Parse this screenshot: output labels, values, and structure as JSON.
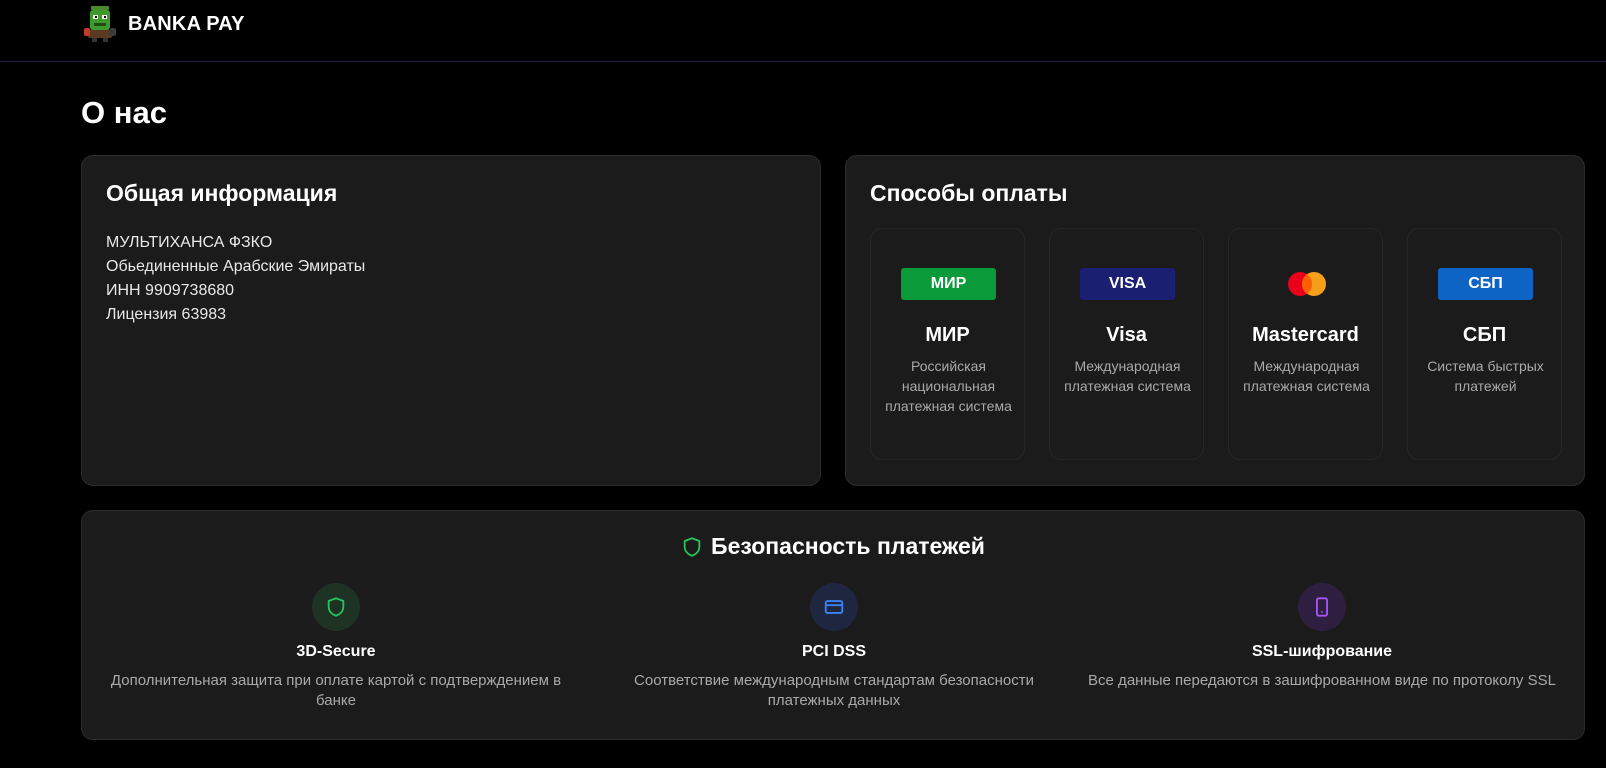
{
  "header": {
    "brand": "BANKA PAY"
  },
  "page": {
    "title": "О нас"
  },
  "info_card": {
    "title": "Общая информация",
    "lines": [
      "МУЛЬТИХАНСА ФЗКО",
      "Обьединенные Арабские Эмираты",
      "ИНН 9909738680",
      "Лицензия 63983"
    ]
  },
  "payment_card": {
    "title": "Способы оплаты",
    "methods": [
      {
        "badge": "МИР",
        "name": "МИР",
        "description": "Российская национальная платежная система",
        "color": "#0a9a3a"
      },
      {
        "badge": "VISA",
        "name": "Visa",
        "description": "Международная платежная система",
        "color": "#1a1f71"
      },
      {
        "badge": "",
        "name": "Mastercard",
        "description": "Международная платежная система",
        "color": "#eb001b"
      },
      {
        "badge": "СБП",
        "name": "СБП",
        "description": "Система быстрых платежей",
        "color": "#0e64c5"
      }
    ]
  },
  "security": {
    "title": "Безопасность платежей",
    "features": [
      {
        "title": "3D-Secure",
        "description": "Дополнительная защита при оплате картой с подтверждением в банке",
        "icon": "shield-icon",
        "color": "#22c55e"
      },
      {
        "title": "PCI DSS",
        "description": "Соответствие международным стандартам безопасности платежных данных",
        "icon": "card-icon",
        "color": "#3b82f6"
      },
      {
        "title": "SSL-шифрование",
        "description": "Все данные передаются в зашифрованном виде по протоколу SSL",
        "icon": "smartphone-icon",
        "color": "#a855f7"
      }
    ]
  }
}
